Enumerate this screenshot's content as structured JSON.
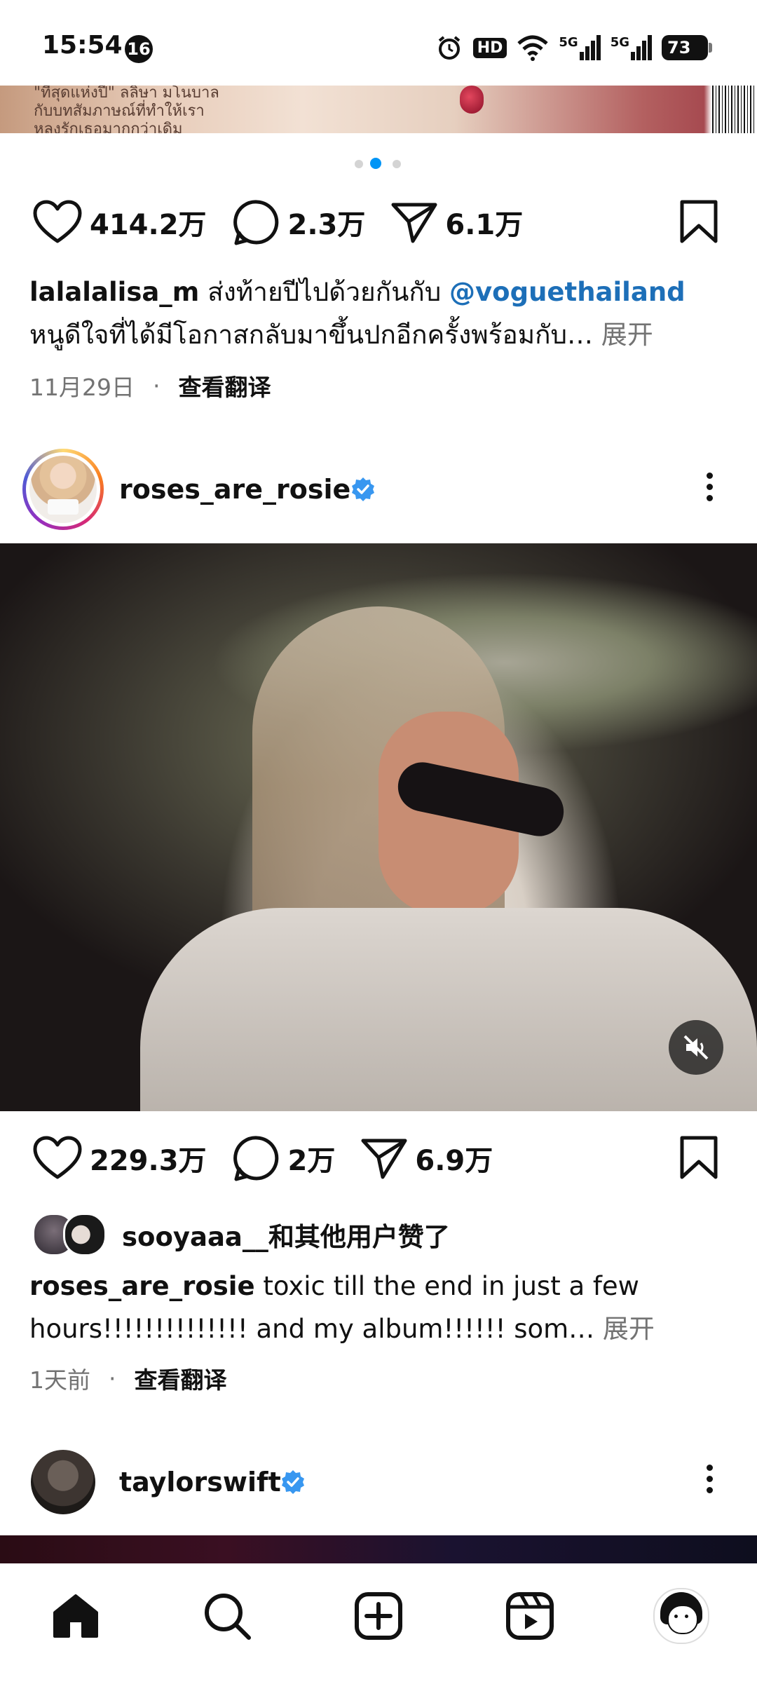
{
  "status_bar": {
    "time": "15:54",
    "notification_count": "16",
    "hd_label": "HD",
    "network_5g_1": "5G",
    "network_5g_2": "5G",
    "battery": "73"
  },
  "post1": {
    "top_image_text_line1": "\"ที่สุดแห่งปี\" ลลิษา มโนบาล",
    "top_image_text_line2": "กับบทสัมภาษณ์ที่ทำให้เรา",
    "top_image_text_line3": "หลงรักเธอมากกว่าเดิม",
    "likes": "414.2万",
    "comments": "2.3万",
    "shares": "6.1万",
    "username": "lalalalisa_m",
    "caption_text": " ส่งท้ายปีไปด้วยกันกับ ",
    "mention": "@voguethailand",
    "caption_line2": "หนูดีใจที่ได้มีโอกาสกลับมาขึ้นปกอีกครั้งพร้อมกับ…",
    "expand": " 展开",
    "date": "11月29日",
    "translate": "查看翻译"
  },
  "post2": {
    "username": "roses_are_rosie",
    "likes": "229.3万",
    "comments": "2万",
    "shares": "6.9万",
    "liked_by": "sooyaaa__和其他用户赞了",
    "caption_username": "roses_are_rosie",
    "caption_text": " toxic till the end in just a few hours!!!!!!!!!!!!!! and my album!!!!!! som…",
    "expand": " 展开",
    "date": "1天前",
    "translate": "查看翻译"
  },
  "post3": {
    "username": "taylorswift"
  },
  "icons": {
    "verified": "verified-badge-icon",
    "like": "heart-icon",
    "comment": "comment-icon",
    "share": "send-icon",
    "save": "bookmark-icon",
    "mute": "muted-speaker-icon"
  },
  "colors": {
    "verified_blue": "#3897f0",
    "mention_blue": "#1d6fb8",
    "active_dot": "#0095f6"
  },
  "nav": {
    "items": [
      "home-icon",
      "search-icon",
      "create-icon",
      "reels-icon",
      "profile-avatar"
    ]
  }
}
